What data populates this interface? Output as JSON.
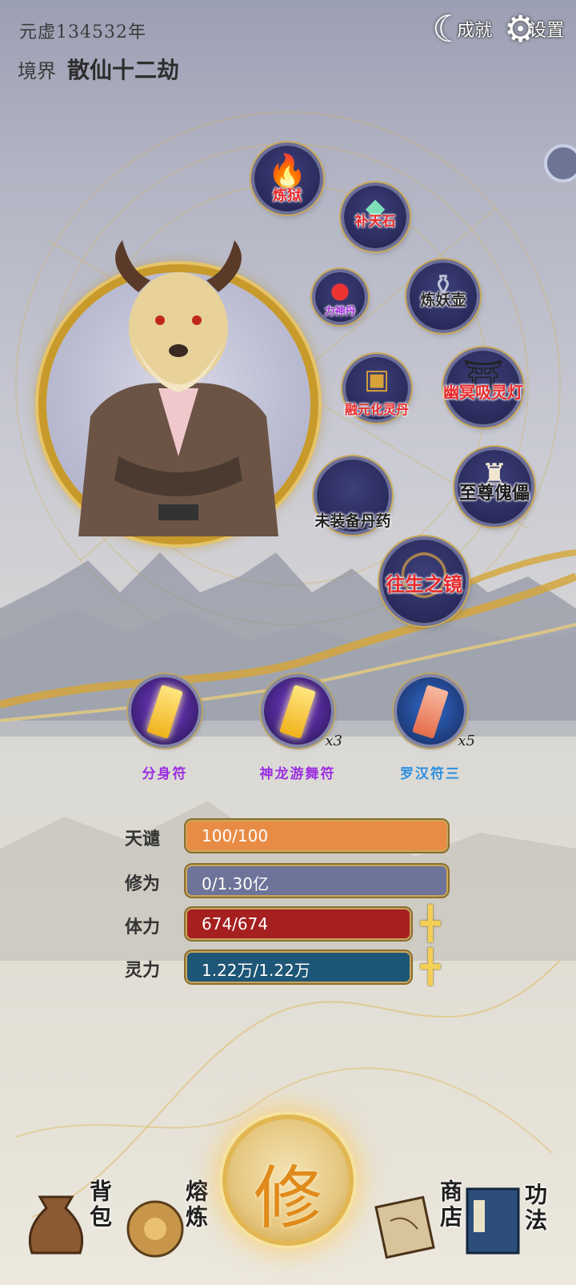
{
  "header": {
    "era_text": "元虚134532年",
    "realm_label": "境界",
    "realm_value": "散仙十二劫",
    "achievements_label": "成就",
    "settings_label": "设置"
  },
  "equipment": [
    {
      "label": "炼狱"
    },
    {
      "label": "补天石"
    },
    {
      "label": "力神丹"
    },
    {
      "label": "炼妖壶"
    },
    {
      "label": "融元化灵丹"
    },
    {
      "label": "幽冥吸灵灯"
    },
    {
      "label": "至尊傀儡"
    },
    {
      "label": "未装备丹药"
    },
    {
      "label": "往生之镜"
    }
  ],
  "talismans": [
    {
      "name": "分身符",
      "count": "",
      "color": "#9b2ee0"
    },
    {
      "name": "神龙游舞符",
      "count": "x3",
      "color": "#9b2ee0"
    },
    {
      "name": "罗汉符三",
      "count": "x5",
      "color": "#2a8fe0"
    }
  ],
  "stats": [
    {
      "label": "天谴",
      "value": "100/100",
      "fill": 1.0,
      "color": "#e88c45",
      "track": "#e88c45",
      "has_plus": false
    },
    {
      "label": "修为",
      "value": "0/1.30亿",
      "fill": 0.0,
      "color": "#6e7399",
      "track": "#6e7399",
      "has_plus": false
    },
    {
      "label": "体力",
      "value": "674/674",
      "fill": 1.0,
      "color": "#a5201f",
      "track": "#a5201f",
      "has_plus": true
    },
    {
      "label": "灵力",
      "value": "1.22万/1.22万",
      "fill": 1.0,
      "color": "#1d5676",
      "track": "#1d5676",
      "has_plus": true
    }
  ],
  "nav": {
    "bag": "背包",
    "smelt": "熔炼",
    "cultivate": "修",
    "shop": "商店",
    "skills": "功法"
  }
}
